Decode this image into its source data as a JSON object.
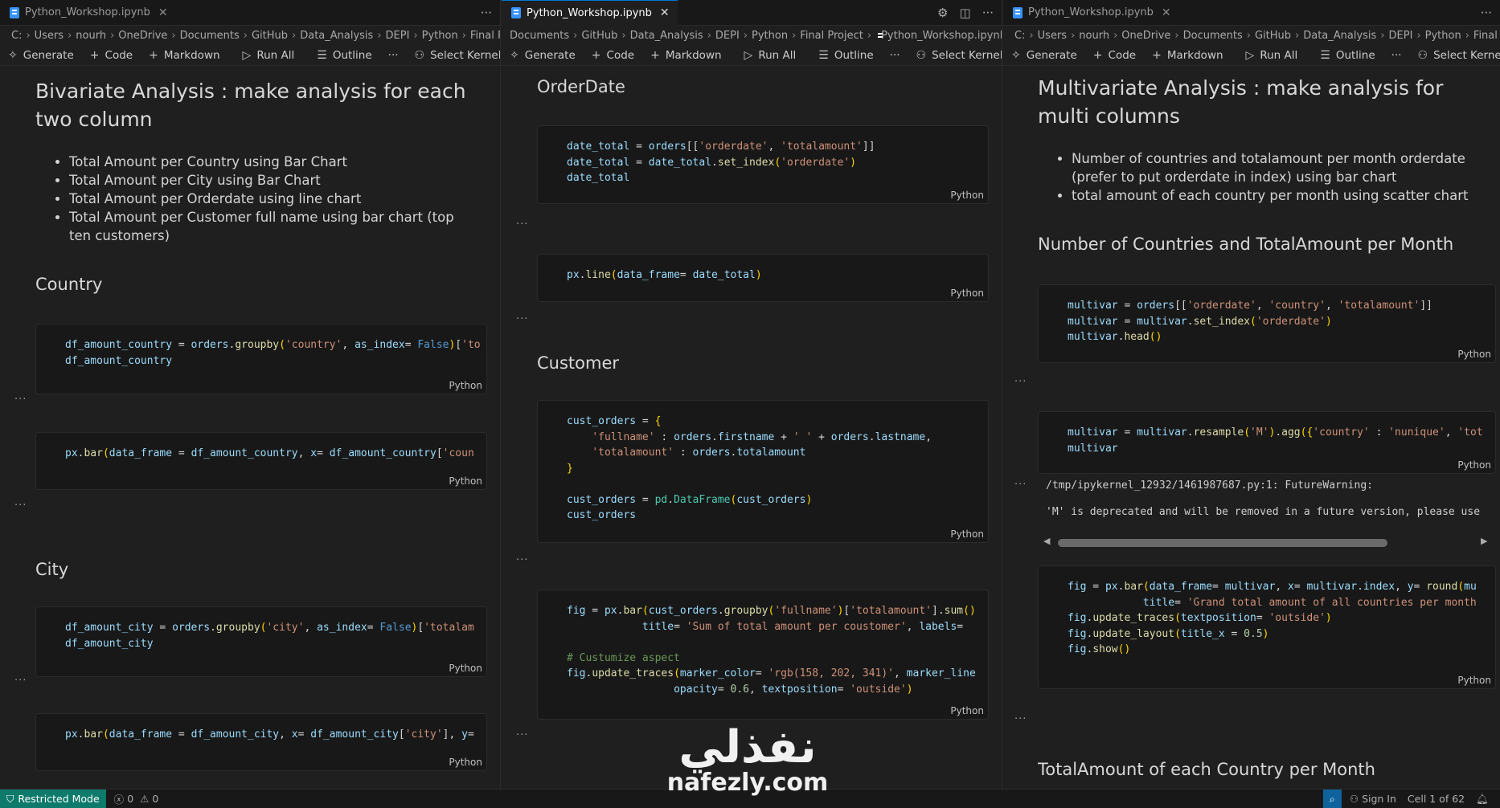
{
  "tabs": [
    {
      "file": "Python_Workshop.ipynb"
    },
    {
      "file": "Python_Workshop.ipynb"
    },
    {
      "file": "Python_Workshop.ipynb"
    }
  ],
  "breadcrumbs": {
    "p1": [
      "C:",
      "Users",
      "nourh",
      "OneDrive",
      "Documents",
      "GitHub",
      "Data_Analysis",
      "DEPI",
      "Python",
      "Final Proje"
    ],
    "p2": [
      "Documents",
      "GitHub",
      "Data_Analysis",
      "DEPI",
      "Python",
      "Final Project",
      "Python_Workshop.ipynb",
      ">"
    ],
    "p3": [
      "C:",
      "Users",
      "nourh",
      "OneDrive",
      "Documents",
      "GitHub",
      "Data_Analysis",
      "DEPI",
      "Python",
      "Final Proj"
    ]
  },
  "toolbar": {
    "generate": "Generate",
    "code": "Code",
    "markdown": "Markdown",
    "run_all": "Run All",
    "outline": "Outline",
    "more": "···",
    "select_kernel": "Select Kernel"
  },
  "pane1": {
    "heading": "Bivariate Analysis : make analysis for each two column",
    "bullets": [
      "Total Amount per Country using Bar Chart",
      "Total Amount per City using Bar Chart",
      "Total Amount per Orderdate using line chart",
      "Total Amount per Customer full name using bar chart (top ten customers)"
    ],
    "h_country": "Country",
    "h_city": "City"
  },
  "pane2": {
    "h_orderdate": "OrderDate",
    "h_customer": "Customer"
  },
  "pane3": {
    "heading": "Multivariate Analysis : make analysis for multi columns",
    "bullets": [
      "Number of countries and totalamount per month orderdate (prefer to put orderdate in index) using bar chart",
      "total amount of each country per month using scatter chart"
    ],
    "h_countries_month": "Number of Countries and TotalAmount per Month",
    "h_partial": "TotalAmount of each Country per Month",
    "output_line1": "/tmp/ipykernel_12932/1461987687.py:1: FutureWarning:",
    "output_line2": "'M' is deprecated and will be removed in a future version, please use"
  },
  "cell_lang": "Python",
  "status": {
    "restricted": "Restricted Mode",
    "errors": "0",
    "warnings": "0",
    "sign_in": "Sign In",
    "cell_pos": "Cell 1 of 62"
  },
  "watermark": {
    "arabic": "نفذلي",
    "latin": "nafezly.com"
  },
  "colors": {
    "accent": "#0078d4",
    "restricted_bg": "#0e7a6b",
    "bg": "#1f1f1f"
  }
}
